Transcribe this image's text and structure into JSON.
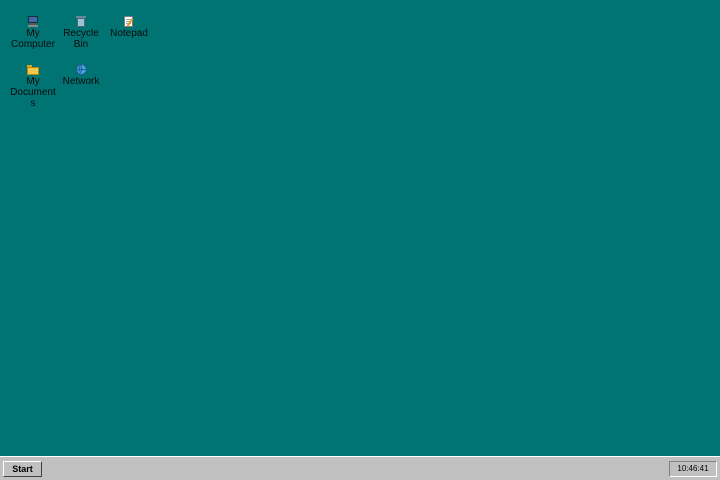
{
  "desktop": {
    "background_color": "#007373",
    "icons": [
      {
        "label": "My Computer",
        "icon": "computer-icon"
      },
      {
        "label": "Recycle Bin",
        "icon": "recycle-bin-icon"
      },
      {
        "label": "Notepad",
        "icon": "notepad-icon"
      },
      {
        "label": "My Documents",
        "icon": "folder-icon"
      },
      {
        "label": "Network",
        "icon": "globe-icon"
      }
    ]
  },
  "taskbar": {
    "start_label": "Start",
    "clock": "10:46:41"
  }
}
